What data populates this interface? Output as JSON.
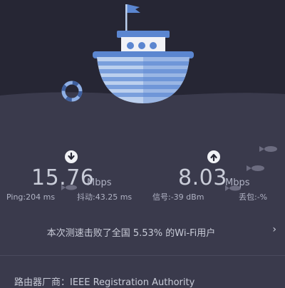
{
  "download": {
    "icon": "arrow-down-icon",
    "value": "15.76",
    "unit": "Mbps",
    "ping": "Ping:204 ms",
    "jitter": "抖动:43.25 ms"
  },
  "upload": {
    "icon": "arrow-up-icon",
    "value": "8.03",
    "unit": "Mbps",
    "signal": "信号:-39 dBm",
    "packet_loss": "丢包:-%"
  },
  "summary": {
    "text": "本次测速击败了全国 5.53% 的Wi-Fi用户",
    "chevron": "›"
  },
  "router": {
    "label": "路由器厂商：IEEE Registration Authority"
  },
  "colors": {
    "sky": "#262634",
    "sea": "#3a3a4c",
    "boat_blue": "#5b86d0",
    "boat_light": "#bcd0ee",
    "fish": "#6c6c80"
  }
}
